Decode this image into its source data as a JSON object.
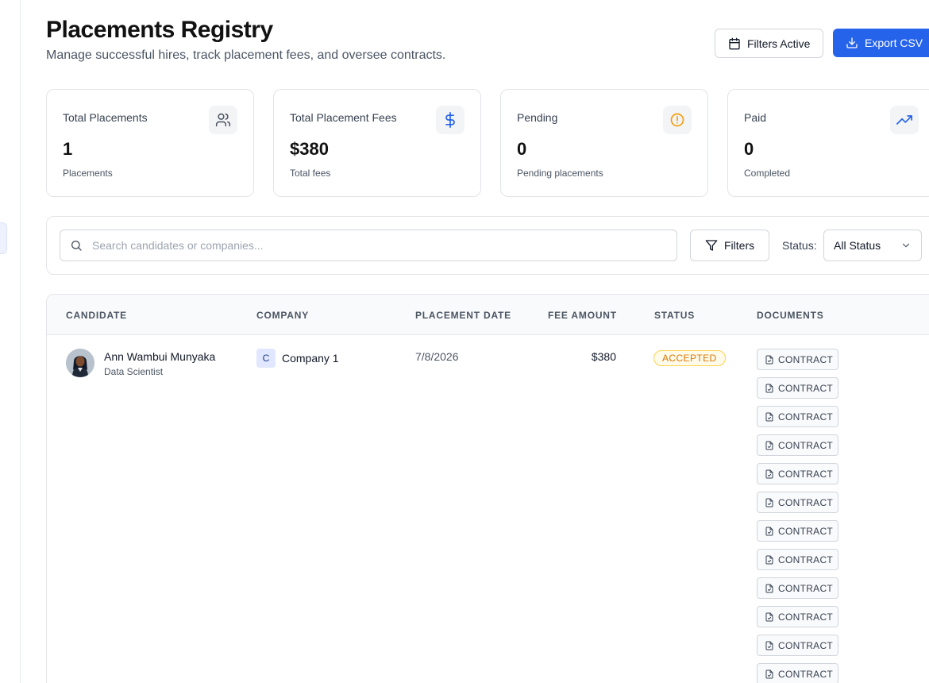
{
  "header": {
    "title": "Placements Registry",
    "subtitle": "Manage successful hires, track placement fees, and oversee contracts.",
    "filters_active_label": "Filters Active",
    "export_label": "Export CSV"
  },
  "stats": [
    {
      "label": "Total Placements",
      "value": "1",
      "sub": "Placements",
      "icon": "users-icon",
      "icon_color": "#4b5563"
    },
    {
      "label": "Total Placement Fees",
      "value": "$380",
      "sub": "Total fees",
      "icon": "dollar-icon",
      "icon_color": "#2563eb"
    },
    {
      "label": "Pending",
      "value": "0",
      "sub": "Pending placements",
      "icon": "alert-circle-icon",
      "icon_color": "#f59e0b"
    },
    {
      "label": "Paid",
      "value": "0",
      "sub": "Completed",
      "icon": "trending-up-icon",
      "icon_color": "#2563eb"
    }
  ],
  "filters": {
    "search_placeholder": "Search candidates or companies...",
    "search_value": "",
    "filters_button_label": "Filters",
    "status_label": "Status:",
    "status_selected": "All Status"
  },
  "table": {
    "columns": [
      "CANDIDATE",
      "COMPANY",
      "PLACEMENT DATE",
      "FEE AMOUNT",
      "STATUS",
      "DOCUMENTS"
    ],
    "rows": [
      {
        "candidate_name": "Ann Wambui Munyaka",
        "candidate_role": "Data Scientist",
        "company_initial": "C",
        "company_name": "Company 1",
        "placement_date": "7/8/2026",
        "fee_amount": "$380",
        "status": "ACCEPTED",
        "documents": [
          "CONTRACT",
          "CONTRACT",
          "CONTRACT",
          "CONTRACT",
          "CONTRACT",
          "CONTRACT",
          "CONTRACT",
          "CONTRACT",
          "CONTRACT",
          "CONTRACT",
          "CONTRACT",
          "CONTRACT"
        ]
      }
    ]
  },
  "colors": {
    "primary": "#2563eb",
    "status_accepted": "#d97706",
    "border": "#e2e4e8"
  }
}
